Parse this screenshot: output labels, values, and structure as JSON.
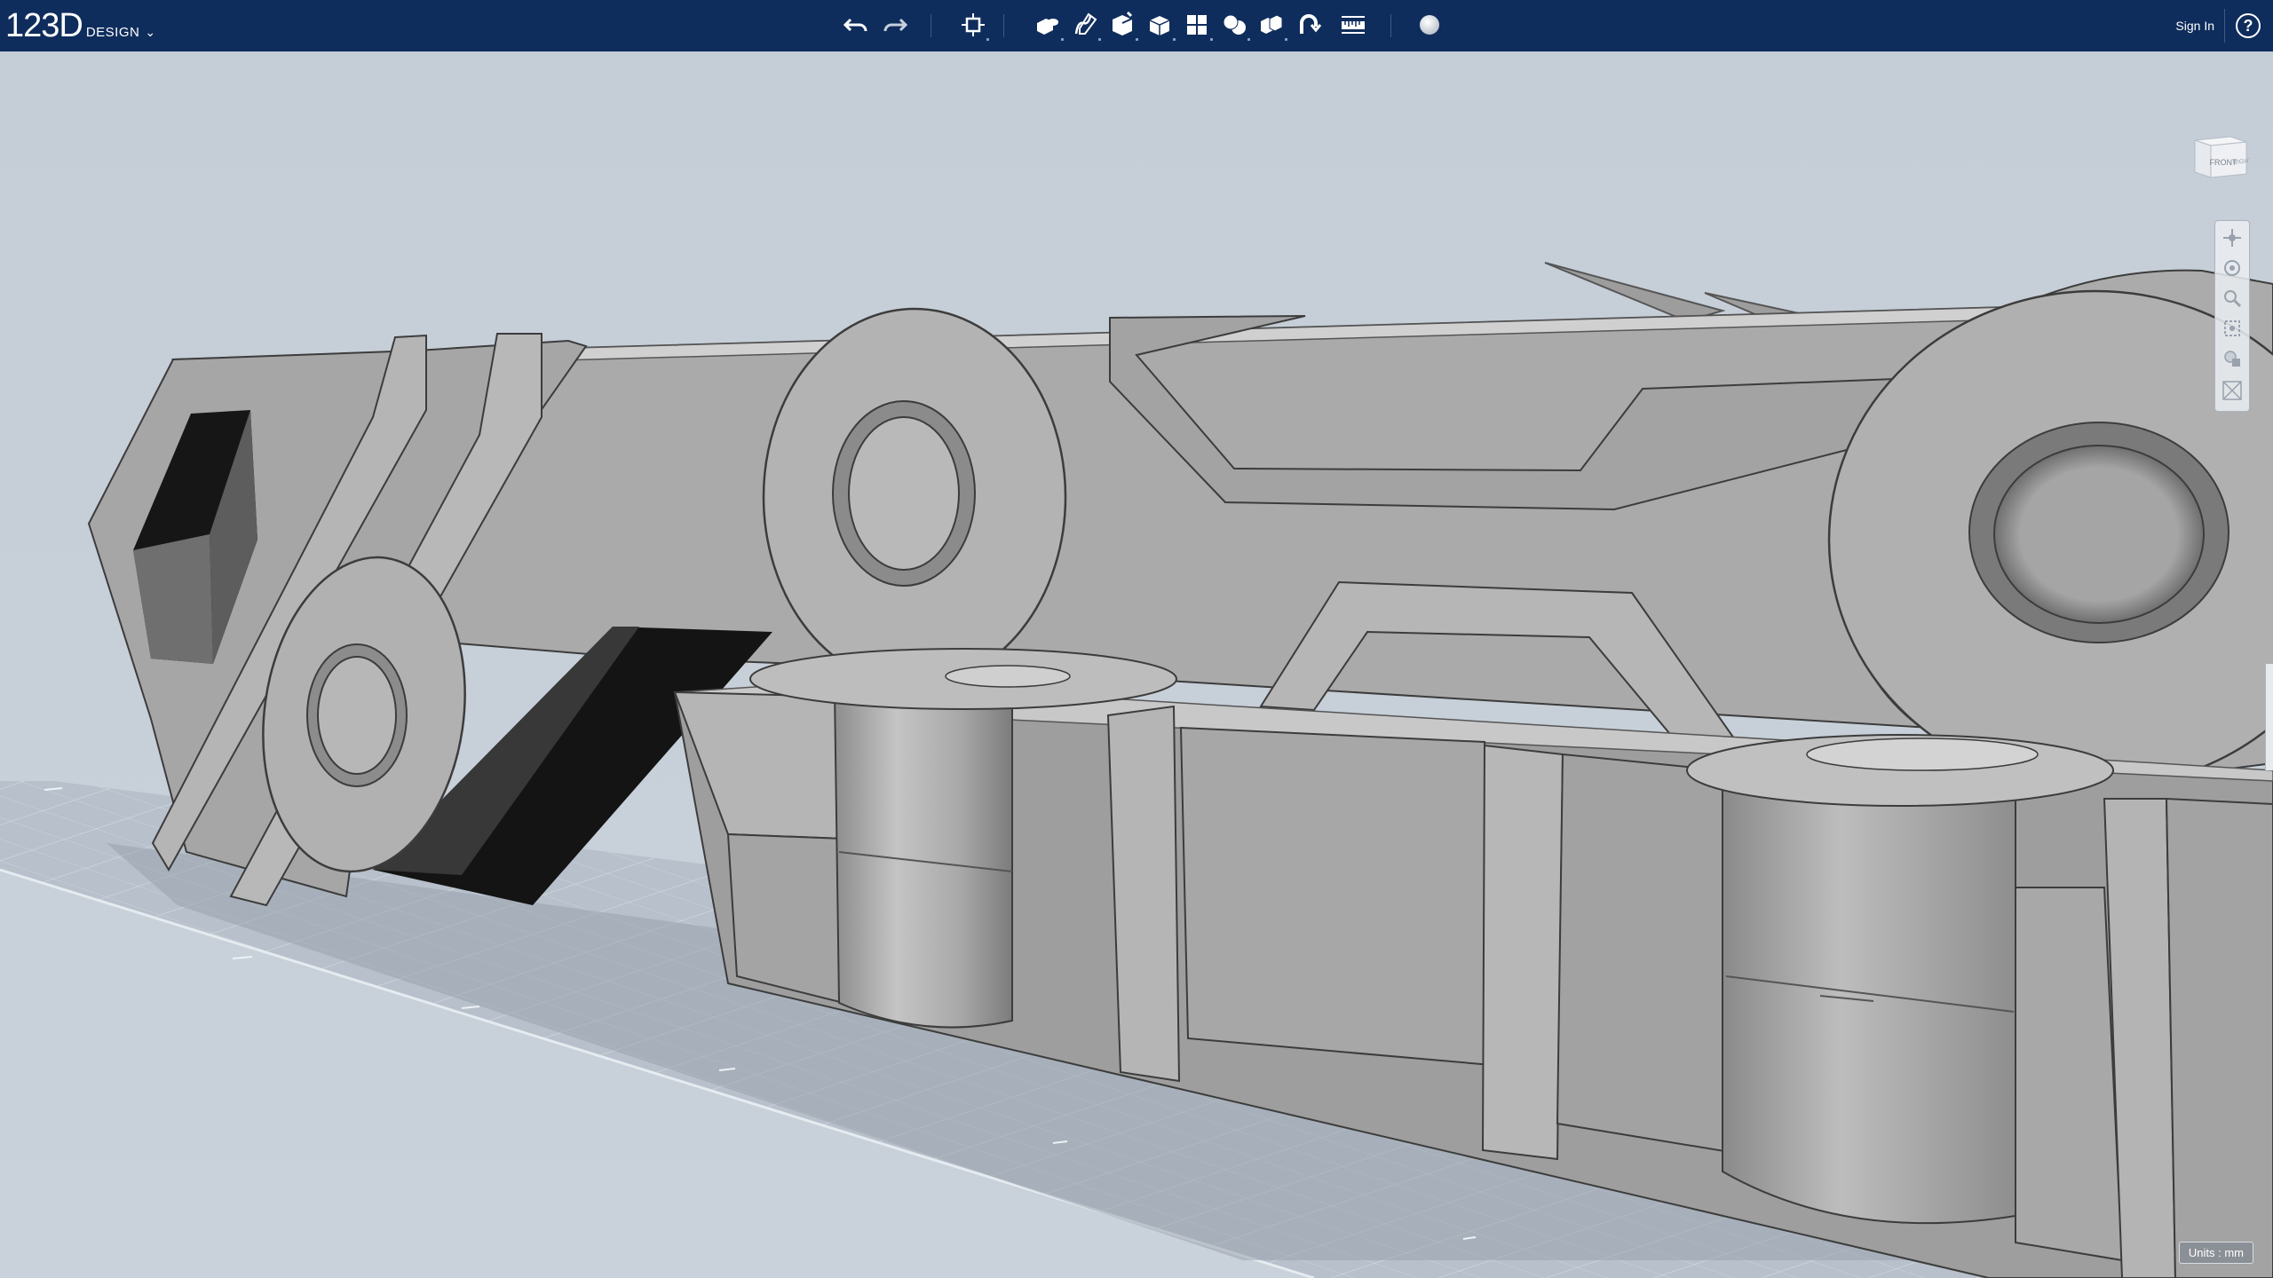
{
  "app": {
    "logo_main": "123D",
    "logo_sub": "DESIGN",
    "menu_chevron": "⌄"
  },
  "toolbar": {
    "undo_icon": "undo-icon",
    "redo_icon": "redo-icon",
    "tools": [
      "transform-icon",
      "primitives-icon",
      "sketch-icon",
      "construct-icon",
      "modify-icon",
      "pattern-icon",
      "grouping-icon",
      "combine-icon",
      "snap-icon",
      "measure-icon",
      "material-icon"
    ],
    "sign_in": "Sign In",
    "help": "?"
  },
  "viewcube": {
    "front": "FRONT",
    "right": "RIGHT"
  },
  "units": "Units : mm",
  "colors": {
    "toolbar_bg": "#0f2d5c",
    "viewport_bg": "#c4ccd6",
    "model_gray": "#a9a9a9"
  }
}
